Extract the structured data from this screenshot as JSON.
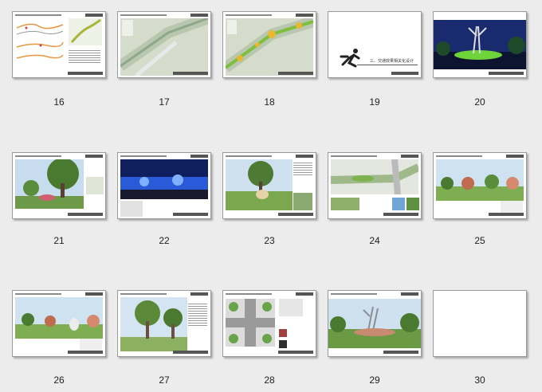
{
  "slides": [
    {
      "number": "16",
      "name": "slide-16-route-plan"
    },
    {
      "number": "17",
      "name": "slide-17-aerial-map"
    },
    {
      "number": "18",
      "name": "slide-18-aerial-map-nodes"
    },
    {
      "number": "19",
      "name": "slide-19-section-title"
    },
    {
      "number": "20",
      "name": "slide-20-night-render"
    },
    {
      "number": "21",
      "name": "slide-21-tree-render"
    },
    {
      "number": "22",
      "name": "slide-22-night-lighting"
    },
    {
      "number": "23",
      "name": "slide-23-sculpture-render"
    },
    {
      "number": "24",
      "name": "slide-24-plan-detail"
    },
    {
      "number": "25",
      "name": "slide-25-garden-render"
    },
    {
      "number": "26",
      "name": "slide-26-garden-render"
    },
    {
      "number": "27",
      "name": "slide-27-tree-render"
    },
    {
      "number": "28",
      "name": "slide-28-intersection-plan"
    },
    {
      "number": "29",
      "name": "slide-29-sculpture-render"
    },
    {
      "number": "30",
      "name": "slide-30-blank"
    }
  ],
  "section_title": "三、交通效果相关化设计",
  "colors": {
    "background": "#ececec",
    "slide_border": "#9a9a9a",
    "sky": "#c8dcef",
    "foliage": "#4f8a3a",
    "night": "#152a7a"
  }
}
